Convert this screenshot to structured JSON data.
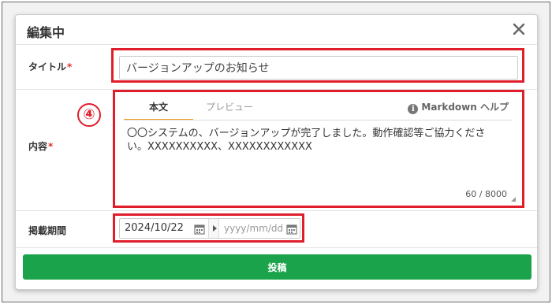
{
  "dialog": {
    "title": "編集中",
    "close_icon": "close-icon"
  },
  "form": {
    "title_label": "タイトル",
    "title_value": "バージョンアップのお知らせ",
    "content_label": "内容",
    "required_mark": "*",
    "tabs": [
      {
        "label": "本文",
        "active": true
      },
      {
        "label": "プレビュー",
        "active": false
      }
    ],
    "markdown_help": "Markdown ヘルプ",
    "info_icon": "i",
    "content_value": "〇〇システムの、バージョンアップが完了しました。動作確認等ご協力ください。XXXXXXXXXX、XXXXXXXXXXXX",
    "char_count": "60 / 8000",
    "period_label": "掲載期間",
    "start_date": "2024/10/22",
    "end_date_placeholder": "yyyy/mm/dd",
    "submit_label": "投稿"
  },
  "annotation": {
    "marker": "④",
    "color": "#e01e2b"
  },
  "colors": {
    "accent_tab": "#f0a020",
    "submit_bg": "#1aa34a",
    "required": "#e03030"
  }
}
